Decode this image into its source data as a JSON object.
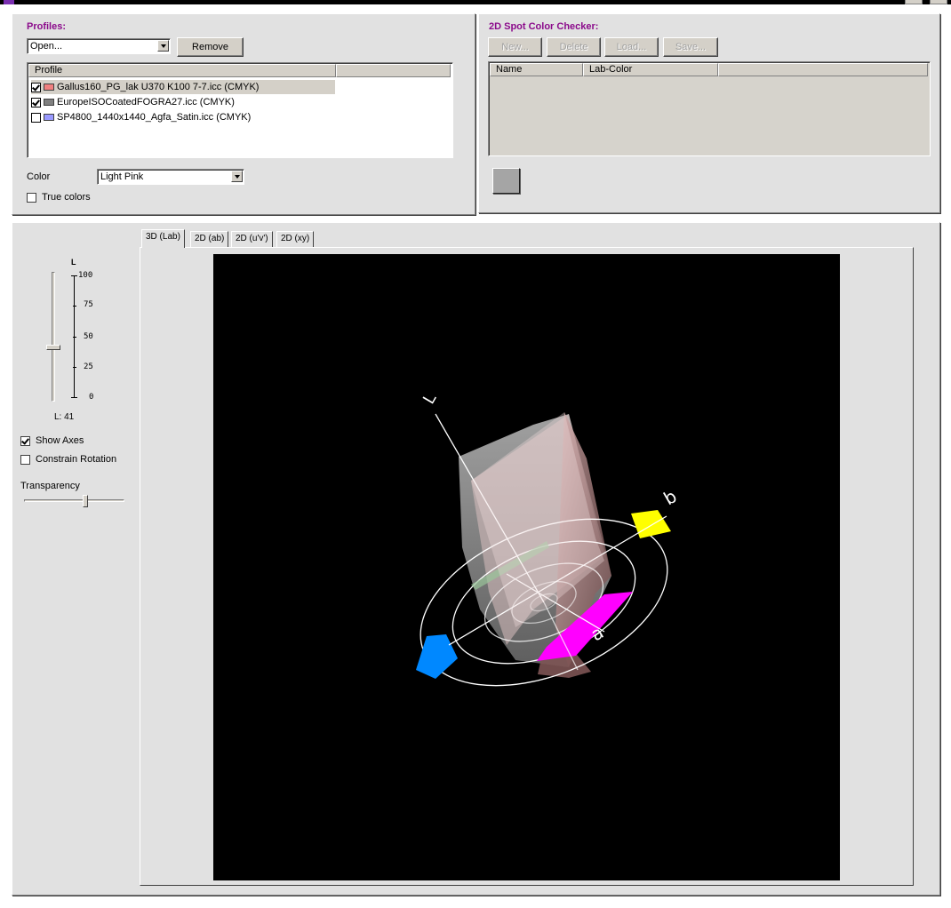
{
  "profiles": {
    "title": "Profiles:",
    "open_combo": "Open...",
    "remove_label": "Remove",
    "column_header": "Profile",
    "items": [
      {
        "label": "Gallus160_PG_lak U370 K100 7-7.icc (CMYK)",
        "checked": true,
        "color": "#f08080",
        "selected": true
      },
      {
        "label": "EuropeISOCoatedFOGRA27.icc (CMYK)",
        "checked": true,
        "color": "#808080",
        "selected": false
      },
      {
        "label": "SP4800_1440x1440_Agfa_Satin.icc (CMYK)",
        "checked": false,
        "color": "#9999ff",
        "selected": false
      }
    ],
    "color_label": "Color",
    "color_value": "Light Pink",
    "true_colors_label": "True colors",
    "true_colors_checked": false
  },
  "spot_checker": {
    "title": "2D Spot Color Checker:",
    "buttons": {
      "new": "New...",
      "delete": "Delete",
      "load": "Load...",
      "save": "Save..."
    },
    "columns": {
      "name": "Name",
      "lab": "Lab-Color"
    },
    "swatch_color": "#a5a5a5"
  },
  "controls": {
    "l_axis_label": "L",
    "scale_labels": [
      "100",
      "75",
      "50",
      "25",
      "0"
    ],
    "l_value_text": "L: 41",
    "l_value": 41,
    "show_axes_label": "Show Axes",
    "show_axes_checked": true,
    "constrain_rotation_label": "Constrain Rotation",
    "constrain_rotation_checked": false,
    "transparency_label": "Transparency",
    "transparency_value": 0.6
  },
  "tabs": [
    {
      "label": "3D (Lab)",
      "active": true
    },
    {
      "label": "2D (ab)",
      "active": false
    },
    {
      "label": "2D (u'v')",
      "active": false
    },
    {
      "label": "2D (xy)",
      "active": false
    }
  ],
  "viewport": {
    "axis_labels": {
      "l": "L",
      "a": "a",
      "b": "b"
    },
    "ring_colors": {
      "yellow": "#ffff00",
      "magenta": "#ff00ff",
      "cyan": "#0088ff"
    }
  }
}
